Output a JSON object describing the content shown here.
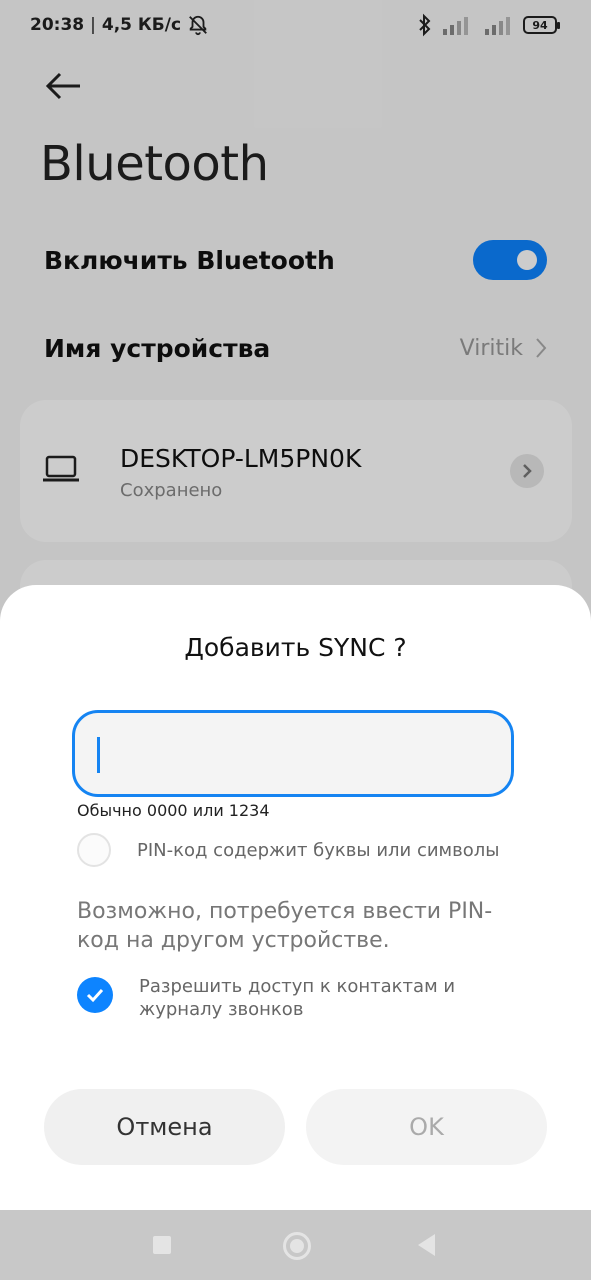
{
  "status_bar": {
    "time": "20:38",
    "separator": "|",
    "speed": "4,5 КБ/с",
    "battery": "94"
  },
  "header": {
    "back_icon": "arrow-left-icon",
    "title": "Bluetooth"
  },
  "settings": {
    "enable_label": "Включить Bluetooth",
    "enable_state": true,
    "device_name_label": "Имя устройства",
    "device_name_value": "Viritik"
  },
  "paired_device": {
    "name": "DESKTOP-LM5PN0K",
    "status": "Сохранено",
    "icon": "laptop-icon"
  },
  "dialog": {
    "title": "Добавить SYNC ?",
    "pin_value": "",
    "pin_hint": "Обычно 0000 или 1234",
    "pin_letters_label": "PIN-код содержит буквы или символы",
    "pin_letters_checked": false,
    "note": "Возможно, потребуется ввести PIN-код на другом устройстве.",
    "access_label": "Разрешить доступ к контактам и журналу звонков",
    "access_checked": true,
    "cancel_label": "Отмена",
    "ok_label": "OK"
  },
  "colors": {
    "accent": "#0d84ff",
    "input_border": "#1584f2"
  }
}
